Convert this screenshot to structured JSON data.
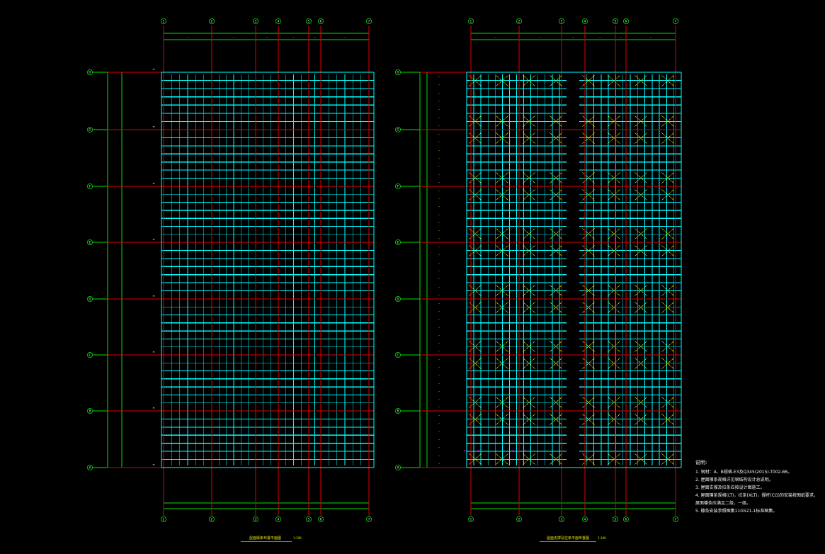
{
  "drawing": {
    "colors": {
      "background": "#000000",
      "axis_line": "#e00000",
      "dimension": "#00e000",
      "purlin": "#00ffff",
      "brace": "#e8e800",
      "text": "#f2f2f2",
      "callout": "#ff00ff"
    },
    "plan_left": {
      "title": "屋面檩条布置平面图",
      "scale": "1:100",
      "col_axes": [
        "1",
        "2",
        "3",
        "4",
        "5",
        "6",
        "7"
      ],
      "row_axes": [
        "H",
        "G",
        "F",
        "E",
        "D",
        "C",
        "B",
        "A"
      ]
    },
    "plan_right": {
      "title": "屋面支撑及拉条平面布置图",
      "scale": "1:100",
      "col_axes": [
        "1",
        "2",
        "3",
        "4",
        "5",
        "6",
        "7"
      ],
      "row_axes": [
        "H",
        "G",
        "F",
        "E",
        "D",
        "C",
        "B",
        "A"
      ]
    },
    "notes": {
      "title": "说明:",
      "items": [
        "1. 钢材：A、B规格-E3及Q345(2015)-T002-B6。",
        "2. 屋面檩条规格详见钢结构设计总说明。",
        "3. 屋面支撑及拉条应按设计图施工。",
        "4. 屋面檩条规格(LT)，拉条(XLT)，撑杆(CG)的安装按图纸要求，",
        "   屋面檩条应满足二级，一级。",
        "5. 檩条安装参照图集11G521-1标准图集。"
      ]
    }
  }
}
